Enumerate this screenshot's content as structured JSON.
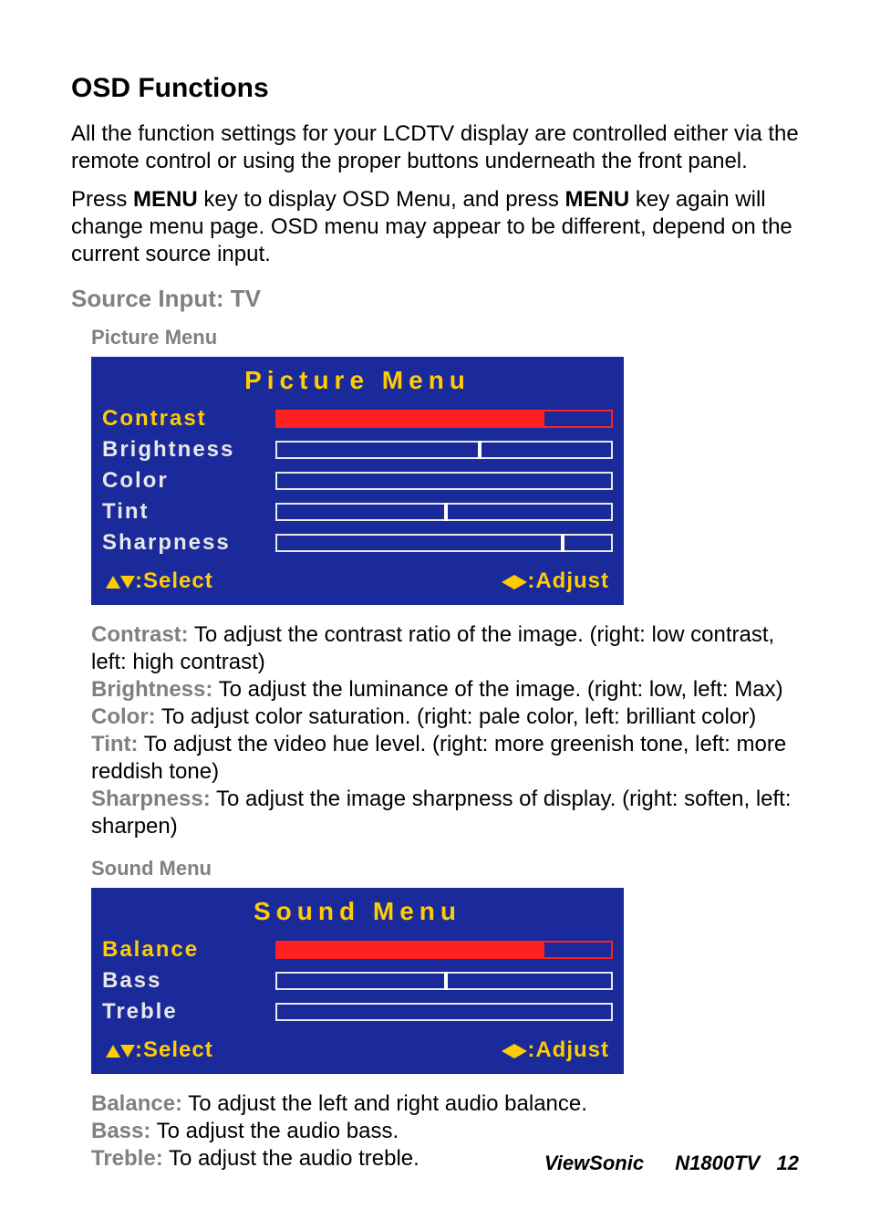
{
  "heading": "OSD Functions",
  "para1": "All the function settings for your LCDTV display are controlled either via the remote control or using the proper buttons underneath the front panel.",
  "para2_a": "Press ",
  "para2_menu1": "MENU",
  "para2_b": " key to display OSD Menu, and press ",
  "para2_menu2": "MENU",
  "para2_c": " key again will change menu page. OSD menu may appear to be different, depend on the current source input.",
  "source_label": "Source Input: TV",
  "picture_menu_label": "Picture Menu",
  "sound_menu_label": "Sound Menu",
  "picture": {
    "title": "Picture Menu",
    "rows": [
      {
        "label": "Contrast",
        "sel": true,
        "fill": 80,
        "marker": null
      },
      {
        "label": "Brightness",
        "sel": false,
        "fill": 0,
        "marker": 60
      },
      {
        "label": "Color",
        "sel": false,
        "fill": 0,
        "marker": null
      },
      {
        "label": "Tint",
        "sel": false,
        "fill": 0,
        "marker": 50
      },
      {
        "label": "Sharpness",
        "sel": false,
        "fill": 0,
        "marker": 85
      }
    ],
    "footer_left": ":Select",
    "footer_right": ":Adjust"
  },
  "sound": {
    "title": "Sound Menu",
    "rows": [
      {
        "label": "Balance",
        "sel": true,
        "fill": 80,
        "marker": null
      },
      {
        "label": "Bass",
        "sel": false,
        "fill": 0,
        "marker": 50
      },
      {
        "label": "Treble",
        "sel": false,
        "fill": 0,
        "marker": null
      }
    ],
    "footer_left": ":Select",
    "footer_right": ":Adjust"
  },
  "desc_picture": [
    {
      "label": "Contrast:",
      "text": " To adjust the contrast ratio of the image. (right: low contrast, left: high contrast)"
    },
    {
      "label": "Brightness:",
      "text": " To adjust the luminance of the image. (right: low, left: Max)"
    },
    {
      "label": "Color:",
      "text": " To adjust color saturation. (right: pale color, left: brilliant color)"
    },
    {
      "label": "Tint:",
      "text": " To adjust the video hue level. (right: more greenish tone, left: more reddish tone)"
    },
    {
      "label": "Sharpness:",
      "text": " To adjust the image sharpness of display. (right: soften, left: sharpen)"
    }
  ],
  "desc_sound": [
    {
      "label": "Balance:",
      "text": " To adjust the left and right audio balance."
    },
    {
      "label": "Bass:",
      "text": " To adjust the audio bass."
    },
    {
      "label": "Treble:",
      "text": " To adjust the audio treble."
    }
  ],
  "footer": {
    "brand": "ViewSonic",
    "model": "N1800TV",
    "page": "12"
  }
}
